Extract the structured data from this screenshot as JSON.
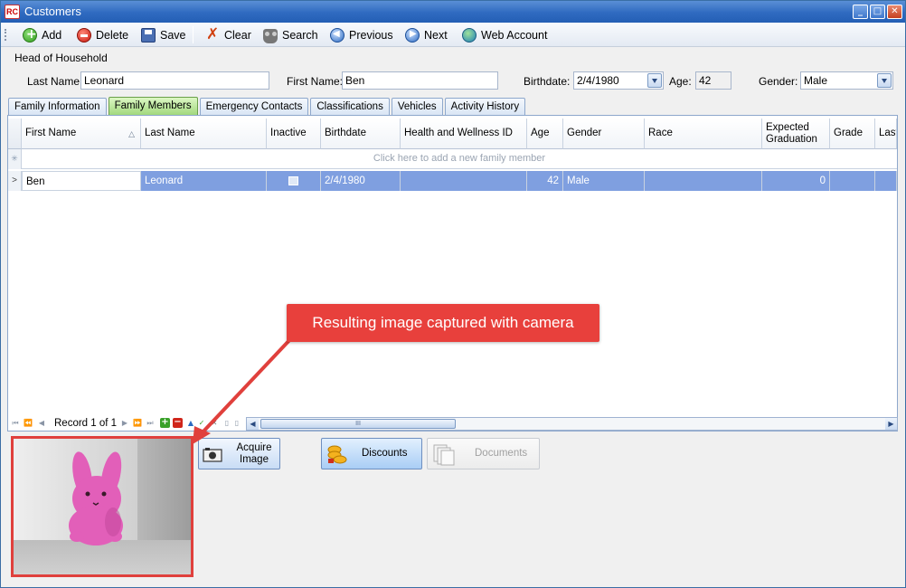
{
  "window": {
    "title": "Customers",
    "app_icon_text": "RC",
    "controls": {
      "minimize": "_",
      "maximize": "□",
      "close": "✕"
    }
  },
  "toolbar": {
    "add": "Add",
    "delete": "Delete",
    "save": "Save",
    "clear": "Clear",
    "search": "Search",
    "previous": "Previous",
    "next": "Next",
    "web_account": "Web Account"
  },
  "household": {
    "section_title": "Head of Household",
    "last_name_label": "Last Name:",
    "last_name": "Leonard",
    "first_name_label": "First Name:",
    "first_name": "Ben",
    "birthdate_label": "Birthdate:",
    "birthdate": "2/4/1980",
    "age_label": "Age:",
    "age": "42",
    "gender_label": "Gender:",
    "gender": "Male"
  },
  "tabs": [
    {
      "label": "Family Information",
      "active": false
    },
    {
      "label": "Family Members",
      "active": true
    },
    {
      "label": "Emergency Contacts",
      "active": false
    },
    {
      "label": "Classifications",
      "active": false
    },
    {
      "label": "Vehicles",
      "active": false
    },
    {
      "label": "Activity History",
      "active": false
    }
  ],
  "grid": {
    "columns": [
      "First Name",
      "Last Name",
      "Inactive",
      "Birthdate",
      "Health and Wellness ID",
      "Age",
      "Gender",
      "Race",
      "Expected Graduation",
      "Grade",
      "Last"
    ],
    "sort_indicator": "△",
    "new_row_hint": "Click here to add a new family member",
    "new_row_marker": "✳",
    "row_marker": ">",
    "rows": [
      {
        "first_name": "Ben",
        "last_name": "Leonard",
        "inactive": false,
        "birthdate": "2/4/1980",
        "health_id": "",
        "age": "42",
        "gender": "Male",
        "race": "",
        "expected_graduation": "0",
        "grade": "",
        "last": ""
      }
    ]
  },
  "navigator": {
    "record_text": "Record 1 of 1",
    "scroll_grip": "III"
  },
  "buttons": {
    "acquire_image": "Acquire Image",
    "discounts": "Discounts",
    "documents": "Documents"
  },
  "callout": {
    "text": "Resulting image captured with camera"
  },
  "colors": {
    "title_bar": "#2f6ac0",
    "active_tab": "#9fd77a",
    "selected_row": "#7f9fe0",
    "callout": "#e8403c",
    "photo_subject": "#e25fb9"
  }
}
